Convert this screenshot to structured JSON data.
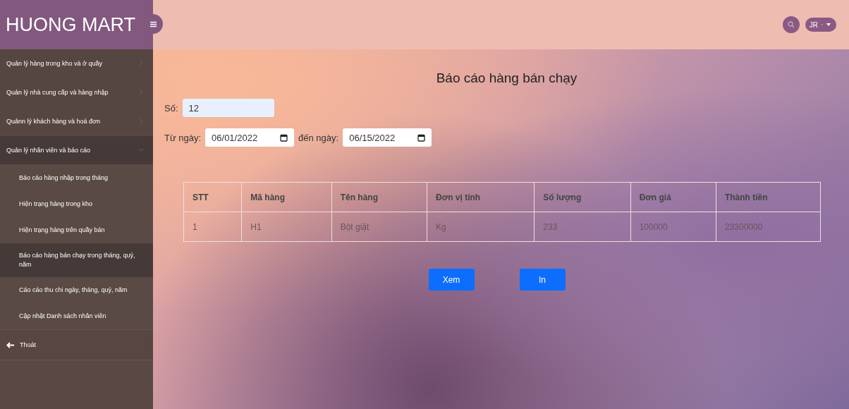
{
  "brand": "HUONG MART",
  "sidebar": {
    "items": [
      {
        "label": "Quản lý hàng trong kho và ở quầy",
        "expanded": false
      },
      {
        "label": "Quản lý nhà cung cấp và hàng nhập",
        "expanded": false
      },
      {
        "label": "Quảnn lý khách hàng và hoá đơn",
        "expanded": false
      },
      {
        "label": "Quản lý nhân viên và báo cáo",
        "expanded": true,
        "children": [
          {
            "label": "Báo cáo hàng nhập trong tháng",
            "selected": false
          },
          {
            "label": "Hiện trạng hàng trong kho",
            "selected": false
          },
          {
            "label": "Hiện trạng hàng trên quầy bán",
            "selected": false
          },
          {
            "label": "Báo cáo hàng bán chạy trong tháng, quý, năm",
            "selected": true
          },
          {
            "label": "Cáo cáo thu chi ngày, tháng, quý, năm",
            "selected": false
          },
          {
            "label": "Cập nhật Danh sách nhân viên",
            "selected": false
          }
        ]
      }
    ],
    "logout": "Thoát"
  },
  "user": {
    "initials": "JR"
  },
  "title": "Báo cáo hàng bán chạy",
  "form": {
    "count_label": "Số:",
    "count_value": "12",
    "from_label": "Từ ngày:",
    "from_value": "06/01/2022",
    "to_label": "đến ngày:",
    "to_value": "06/15/2022"
  },
  "table": {
    "columns": [
      "STT",
      "Mã hàng",
      "Tên hàng",
      "Đơn vị tính",
      "Số lượng",
      "Đơn giá",
      "Thành tiền"
    ],
    "rows": [
      [
        "1",
        "H1",
        "Bột giặt",
        "Kg",
        "233",
        "100000",
        "23300000"
      ]
    ]
  },
  "buttons": [
    "Xem",
    "In"
  ]
}
